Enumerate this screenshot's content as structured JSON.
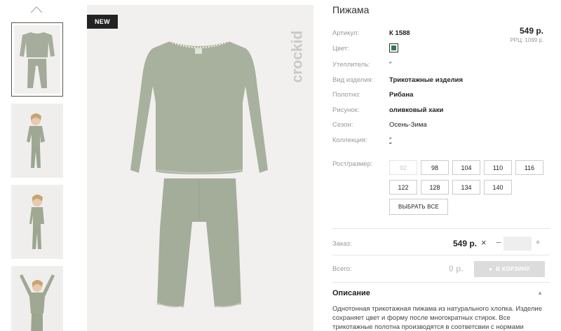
{
  "gallery": {
    "badge": "NEW",
    "brand": "crockid"
  },
  "product": {
    "title": "Пижама",
    "price": "549 р.",
    "rrp": "РРЦ: 1099 р.",
    "color_hex": "#2e7b4f",
    "attributes": [
      {
        "label": "Артикул:",
        "value": "К 1588",
        "bold": true
      },
      {
        "label": "Цвет:",
        "value": "",
        "bold": false
      },
      {
        "label": "Утеплитель:",
        "value": "\"",
        "bold": false
      },
      {
        "label": "Вид изделия:",
        "value": "Трикотажные изделия",
        "bold": true
      },
      {
        "label": "Полотно:",
        "value": "Рибана",
        "bold": true
      },
      {
        "label": "Рисунок:",
        "value": "оливковый хаки",
        "bold": true
      },
      {
        "label": "Сезон:",
        "value": "Осень-Зима",
        "bold": false
      },
      {
        "label": "Коллекция:",
        "value": "\"",
        "bold": false
      }
    ],
    "size_label": "Рост/размер:",
    "sizes": [
      {
        "value": "92",
        "disabled": true
      },
      {
        "value": "98",
        "disabled": false
      },
      {
        "value": "104",
        "disabled": false
      },
      {
        "value": "110",
        "disabled": false
      },
      {
        "value": "116",
        "disabled": false
      },
      {
        "value": "122",
        "disabled": false
      },
      {
        "value": "128",
        "disabled": false
      },
      {
        "value": "134",
        "disabled": false
      },
      {
        "value": "140",
        "disabled": false
      }
    ],
    "select_all": "ВЫБРАТЬ ВСЕ"
  },
  "order": {
    "label": "Заказ:",
    "price": "549 р.",
    "remove_symbol": "×",
    "minus": "−",
    "plus": "+",
    "quantity": ""
  },
  "total": {
    "label": "Всего:",
    "value": "0 р.",
    "cart_button": "В КОРЗИНУ"
  },
  "description": {
    "heading": "Описание",
    "text": "Однотонная трикотажная пижама из натурального хлопка. Изделие сохраняет цвет и форму после многократных стирок. Все трикотажные полотна производятся в соответсвии с нормами"
  }
}
